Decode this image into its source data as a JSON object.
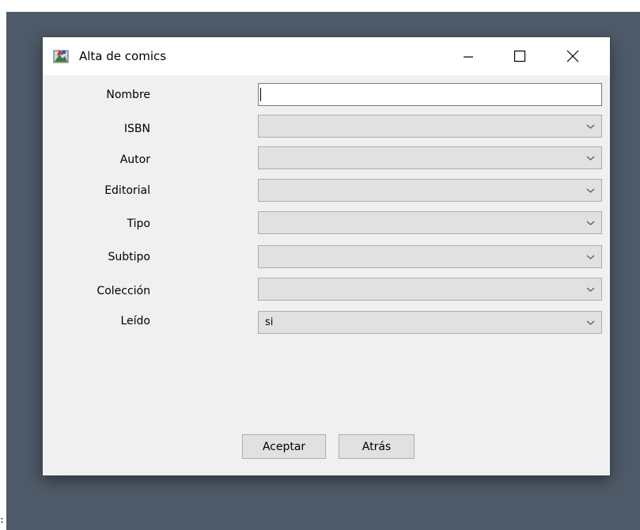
{
  "window": {
    "title": "Alta de comics"
  },
  "form": {
    "fields": [
      {
        "label": "Nombre",
        "kind": "text",
        "value": ""
      },
      {
        "label": "ISBN",
        "kind": "combo",
        "value": ""
      },
      {
        "label": "Autor",
        "kind": "combo",
        "value": ""
      },
      {
        "label": "Editorial",
        "kind": "combo",
        "value": ""
      },
      {
        "label": "Tipo",
        "kind": "combo",
        "value": ""
      },
      {
        "label": "Subtipo",
        "kind": "combo",
        "value": ""
      },
      {
        "label": "Colección",
        "kind": "combo",
        "value": ""
      },
      {
        "label": "Leído",
        "kind": "combo",
        "value": "si"
      }
    ]
  },
  "buttons": {
    "accept_label": "Aceptar",
    "back_label": "Atrás"
  },
  "page": {
    "stray_text": ":"
  },
  "icons": {
    "app": "comic-app-icon",
    "minimize": "minimize-icon",
    "maximize": "maximize-icon",
    "close": "close-icon",
    "dropdown": "chevron-down-icon"
  },
  "colors": {
    "desktop": "#4e5a68",
    "window_body": "#f0f0f0",
    "titlebar": "#ffffff",
    "control_face": "#e1e1e1"
  }
}
